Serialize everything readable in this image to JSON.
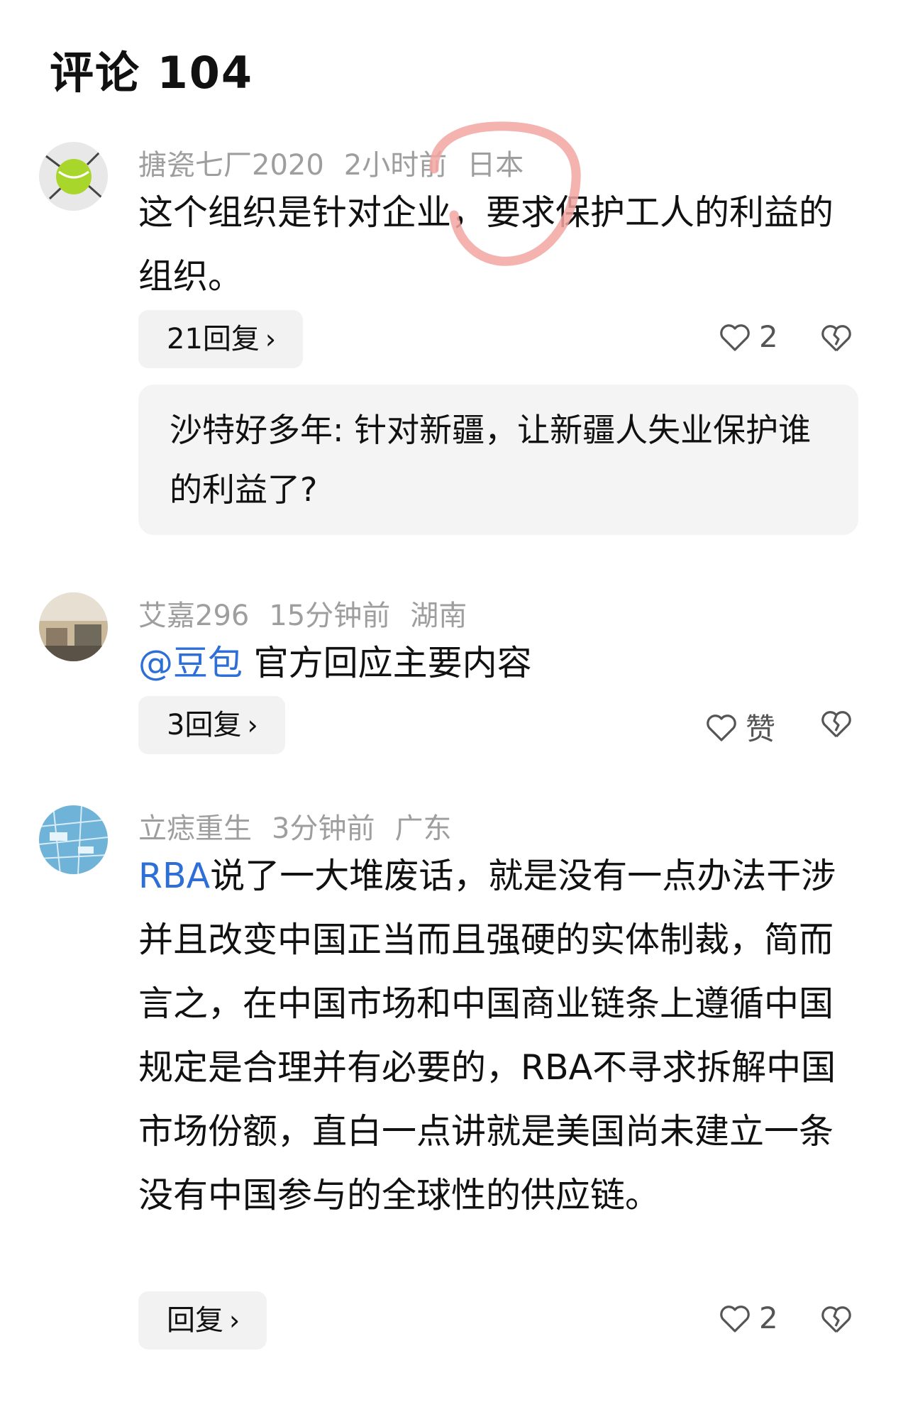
{
  "header": {
    "title": "评论 104"
  },
  "comments": [
    {
      "username": "搪瓷七厂2020",
      "time": "2小时前",
      "location": "日本",
      "text": "这个组织是针对企业，要求保护工人的利益的组织。",
      "replies_label": "21回复",
      "likes": "2",
      "quoted_reply": "沙特好多年: 针对新疆，让新疆人失业保护谁的利益了?"
    },
    {
      "username": "艾嘉296",
      "time": "15分钟前",
      "location": "湖南",
      "mention": "@豆包",
      "text": " 官方回应主要内容",
      "replies_label": "3回复",
      "likes": "赞"
    },
    {
      "username": "立痣重生",
      "time": "3分钟前",
      "location": "广东",
      "mention": "RBA",
      "text": "说了一大堆废话，就是没有一点办法干涉并且改变中国正当而且强硬的实体制裁，简而言之，在中国市场和中国商业链条上遵循中国规定是合理并有必要的，RBA不寻求拆解中国市场份额，直白一点讲就是美国尚未建立一条没有中国参与的全球性的供应链。",
      "replies_label": "回复",
      "likes": "2"
    }
  ],
  "icons": {
    "reply_chevron": "chevron-right-icon",
    "like": "heart-outline-icon",
    "dislike": "broken-heart-icon"
  },
  "colors": {
    "mention": "#2d6fd6",
    "meta": "#9e9e9e",
    "annotation_circle": "#f2a6a0"
  }
}
